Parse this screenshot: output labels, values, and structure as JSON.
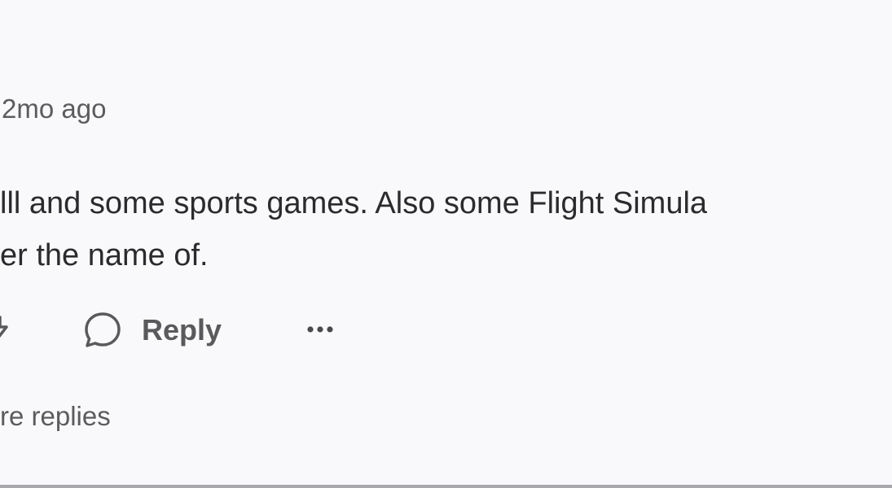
{
  "comment": {
    "timestamp": "2mo ago",
    "body_lines": [
      "lll and some sports games. Also some Flight Simula",
      "er the name of."
    ]
  },
  "actions": {
    "reply_label": "Reply",
    "vote_icon": "downvote-arrow-icon",
    "reply_icon": "speech-bubble-icon",
    "more_icon": "ellipsis-icon"
  },
  "replies": {
    "more_label": "re replies"
  },
  "colors": {
    "background": "#f9f9fb",
    "text_primary": "#2b2b2d",
    "text_secondary": "#5c5c5e",
    "divider": "#a9a9ad"
  }
}
